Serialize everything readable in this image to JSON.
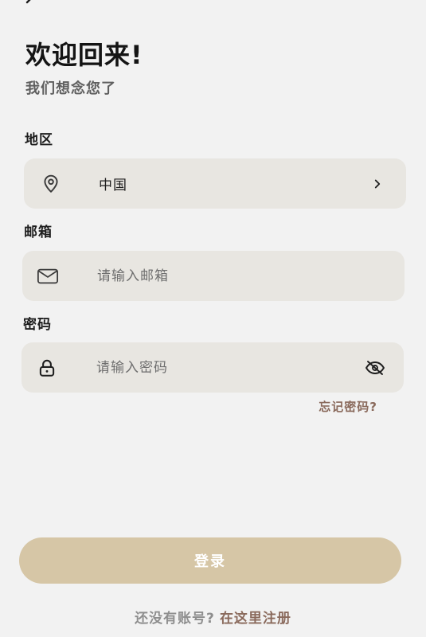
{
  "header": {
    "title": "欢迎回来!",
    "subtitle": "我们想念您了"
  },
  "region": {
    "label": "地区",
    "value": "中国"
  },
  "email": {
    "label": "邮箱",
    "placeholder": "请输入邮箱"
  },
  "password": {
    "label": "密码",
    "placeholder": "请输入密码"
  },
  "forgot_password": "忘记密码?",
  "login_button": "登录",
  "register": {
    "prompt": "还没有账号?",
    "link": "在这里注册"
  },
  "colors": {
    "background": "#f2f2f2",
    "field_bg": "#e8e6e1",
    "primary_button": "#d6c6a6",
    "accent_link": "#8a6a5c"
  },
  "icons": {
    "back": "back-arrow-icon",
    "location": "location-pin-icon",
    "chevron": "chevron-right-icon",
    "mail": "mail-icon",
    "lock": "lock-icon",
    "visibility": "eye-off-icon"
  }
}
